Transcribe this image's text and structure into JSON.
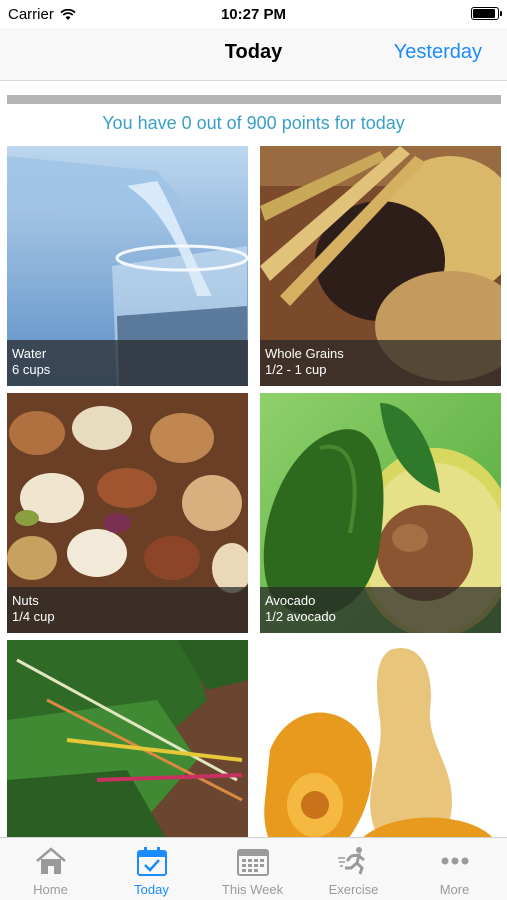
{
  "status": {
    "carrier": "Carrier",
    "time": "10:27 PM"
  },
  "nav": {
    "title": "Today",
    "right_button": "Yesterday"
  },
  "progress": {
    "points_text": "You have 0 out of 900 points for today",
    "fraction": 0
  },
  "tiles": [
    {
      "name": "Water",
      "amount": "6 cups"
    },
    {
      "name": "Whole Grains",
      "amount": "1/2 - 1 cup"
    },
    {
      "name": "Nuts",
      "amount": "1/4 cup"
    },
    {
      "name": "Avocado",
      "amount": "1/2 avocado"
    },
    {
      "name": "",
      "amount": ""
    },
    {
      "name": "",
      "amount": ""
    }
  ],
  "tabs": [
    {
      "label": "Home",
      "icon": "home-icon",
      "active": false
    },
    {
      "label": "Today",
      "icon": "calendar-check-icon",
      "active": true
    },
    {
      "label": "This Week",
      "icon": "calendar-grid-icon",
      "active": false
    },
    {
      "label": "Exercise",
      "icon": "runner-icon",
      "active": false
    },
    {
      "label": "More",
      "icon": "more-dots-icon",
      "active": false
    }
  ],
  "colors": {
    "accent": "#1a8cff",
    "points_text": "#3a9fc8",
    "tab_inactive": "#9a9a9a"
  }
}
